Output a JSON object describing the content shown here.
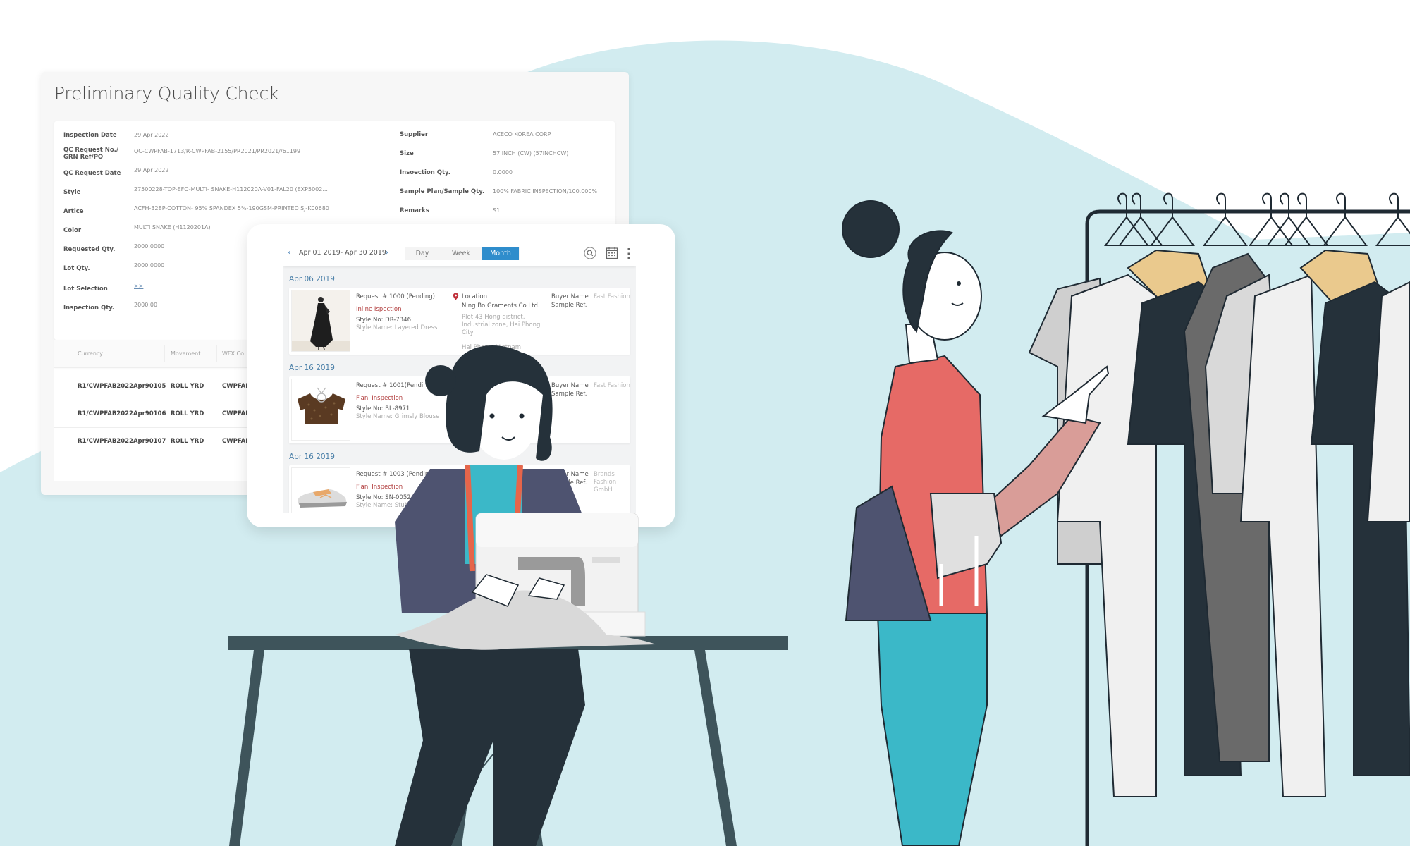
{
  "colors": {
    "background_blob": "#d2ecf0",
    "accent_blue": "#2f8dcc",
    "inspection_red": "#b03a3a",
    "dark_navy": "#25313a",
    "teal": "#3bb8c8",
    "coral": "#e66a66",
    "mustard": "#eac98d"
  },
  "qc_panel": {
    "title": "Preliminary Quality Check",
    "left_fields": [
      {
        "label": "Inspection Date",
        "value": "29 Apr 2022"
      },
      {
        "label": "QC Request No./ GRN Ref/PO",
        "value": "QC-CWPFAB-1713/R-CWPFAB-2155/PR2021/PR2021//61199"
      },
      {
        "label": "QC Request Date",
        "value": "29 Apr 2022"
      },
      {
        "label": "Style",
        "value": "27500228-TOP-EFO-MULTI- SNAKE-H112020A-V01-FAL20 (EXP5002..."
      },
      {
        "label": "Artice",
        "value": "ACFH-328P-COTTON- 95% SPANDEX 5%-190GSM-PRINTED SJ-K00680"
      },
      {
        "label": "Color",
        "value": "MULTI SNAKE (H1120201A)"
      },
      {
        "label": "Requested Qty.",
        "value": "2000.0000"
      },
      {
        "label": "Lot Qty.",
        "value": "2000.0000"
      },
      {
        "label": "Lot Selection",
        "value": ">>"
      },
      {
        "label": "Inspection Qty.",
        "value": "2000.00"
      }
    ],
    "right_fields": [
      {
        "label": "Supplier",
        "value": "ACECO KOREA CORP"
      },
      {
        "label": "Size",
        "value": "57 INCH (CW) (57INCHCW)"
      },
      {
        "label": "Insoection Qty.",
        "value": "0.0000"
      },
      {
        "label": "Sample Plan/Sample Qty.",
        "value": "100% FABRIC INSPECTION/100.000%"
      },
      {
        "label": "Remarks",
        "value": "S1"
      }
    ],
    "table": {
      "headers": [
        "Currency",
        "Movement...",
        "WFX Co"
      ],
      "rows": [
        [
          "R1/CWPFAB2022Apr90105",
          "ROLL YRD",
          "CWPFAB"
        ],
        [
          "R1/CWPFAB2022Apr90106",
          "ROLL YRD",
          "CWPFAB"
        ],
        [
          "R1/CWPFAB2022Apr90107",
          "ROLL YRD",
          "CWPFAB"
        ]
      ]
    }
  },
  "calendar": {
    "date_range": "Apr 01 2019- Apr 30 2019",
    "prev_icon": "chevron-left",
    "next_icon": "chevron-right",
    "views": [
      "Day",
      "Week",
      "Month"
    ],
    "active_view": "Month",
    "search_icon": "search",
    "calendar_icon": "calendar",
    "more_icon": "more-vertical",
    "groups": [
      {
        "date": "Apr 06 2019",
        "request": "Request # 1000 (Pending)",
        "type": "Inline Ispection",
        "style_no": "Style No: DR-7346",
        "style_name": "Style Name: Layered Dress",
        "location_label": "Location",
        "company": "Ning Bo Graments Co Ltd.",
        "address": "Plot 43 Hong district, Industrial zone, Hai Phong City",
        "city": "Hai Phong, Vietnam",
        "buyer_label": "Buyer Name",
        "buyer_value": "Fast Fashion",
        "sample_ref_label": "Sample Ref.",
        "thumb": "dress"
      },
      {
        "date": "Apr 16 2019",
        "request": "Request # 1001(Pending)",
        "type": "Fianl Inspection",
        "style_no": "Style No: BL-8971",
        "style_name": "Style Name: Grimsly Blouse",
        "buyer_label": "Buyer Name",
        "buyer_value": "Fast Fashion",
        "sample_ref_label": "Sample Ref.",
        "thumb": "blouse"
      },
      {
        "date": "Apr 16 2019",
        "request": "Request # 1003 (Pending)",
        "type": "Fianl Inspection",
        "style_no": "Style No: SN-0052",
        "style_name": "Style Name: Stubbs Sneaker",
        "buyer_label": "Buyer Name",
        "buyer_value": "Brands Fashion GmbH",
        "sample_ref_label": "Sample Ref.",
        "thumb": "sneaker"
      }
    ]
  },
  "illustration": {
    "scene": "Seamstress at sewing machine and shopper browsing clothing rack",
    "elements": [
      "seamstress",
      "sewing-machine",
      "work-table",
      "stool",
      "shopper",
      "tote-bag",
      "clothing-rack",
      "hangers"
    ]
  }
}
